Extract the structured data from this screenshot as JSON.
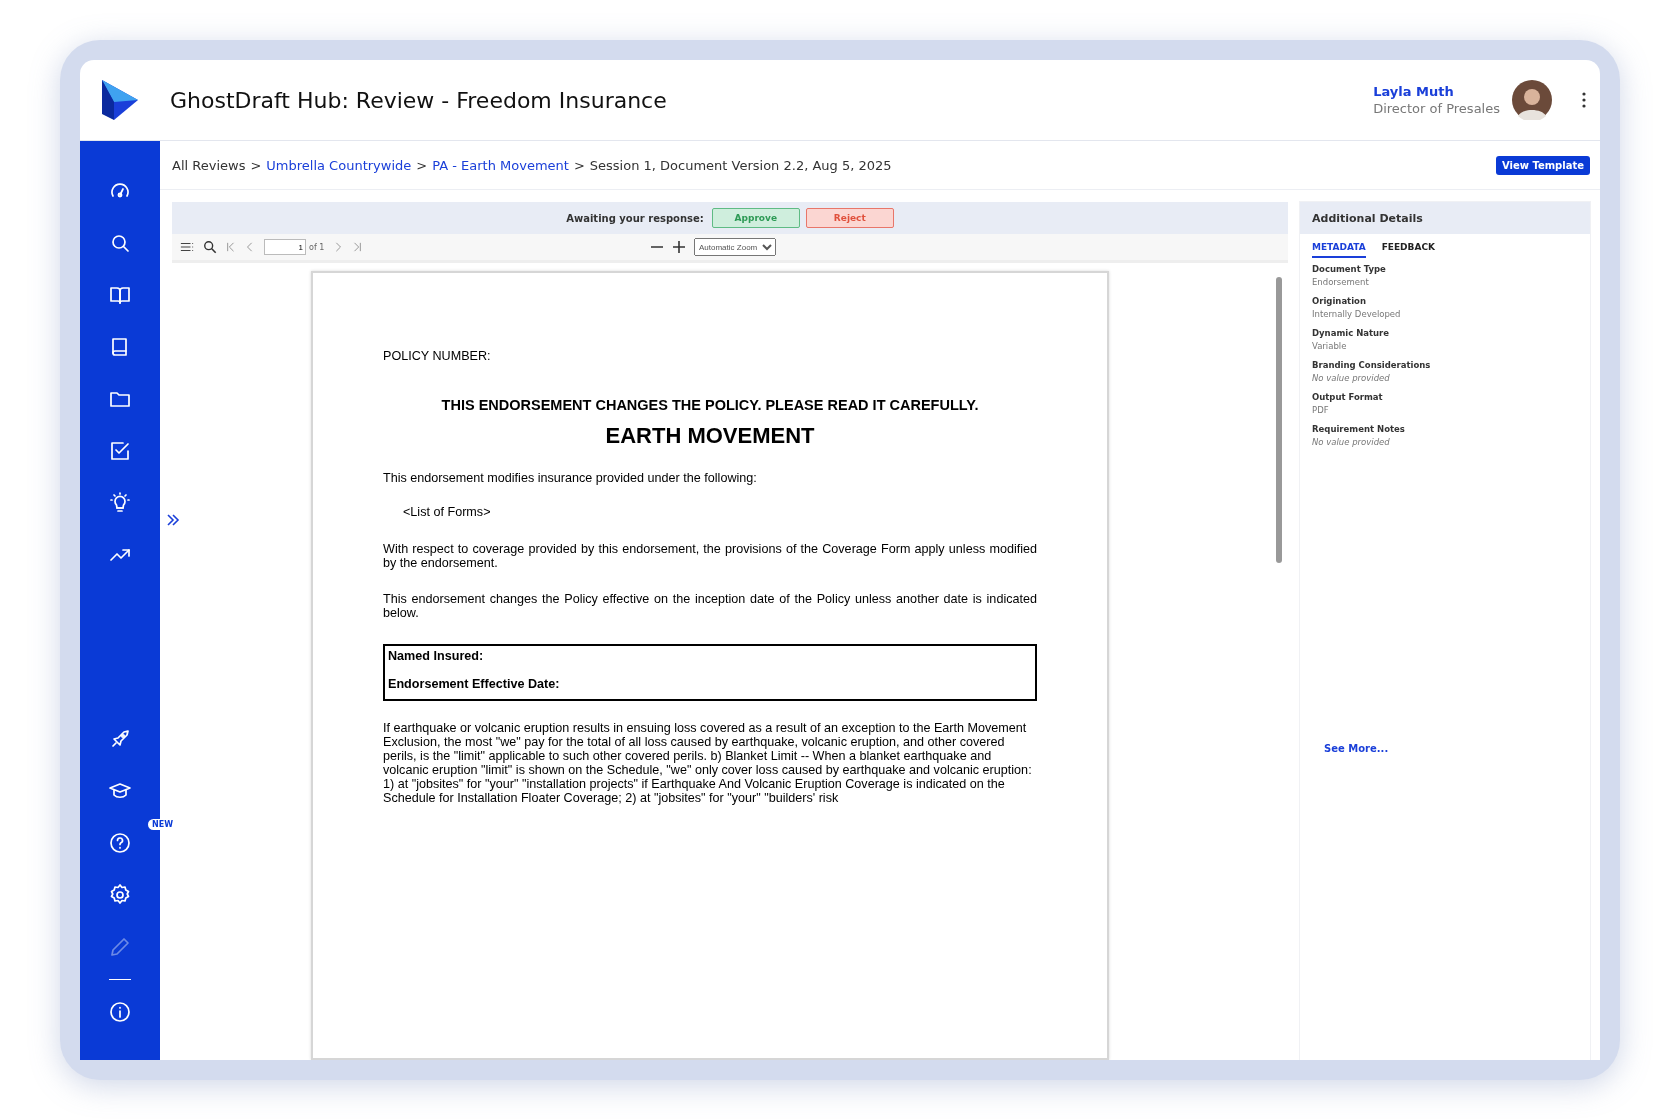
{
  "app": {
    "title": "GhostDraft Hub: Review - Freedom Insurance"
  },
  "user": {
    "name": "Layla Muth",
    "role": "Director of Presales"
  },
  "sidebar": {
    "top": [
      {
        "disabled": false
      },
      {
        "disabled": false
      },
      {
        "disabled": false
      },
      {
        "disabled": false
      },
      {
        "disabled": false
      },
      {
        "disabled": false
      },
      {
        "disabled": false
      },
      {
        "disabled": false
      }
    ],
    "bottom": [
      {
        "disabled": false
      },
      {
        "disabled": false
      },
      {
        "disabled": false,
        "badge": "NEW"
      },
      {
        "disabled": false
      },
      {
        "disabled": true
      },
      {
        "disabled": false
      }
    ]
  },
  "breadcrumb": [
    {
      "kind": "text",
      "label": "All Reviews"
    },
    {
      "kind": "separator",
      "label": ">"
    },
    {
      "kind": "link",
      "label": "Umbrella Countrywide"
    },
    {
      "kind": "separator",
      "label": ">"
    },
    {
      "kind": "link",
      "label": "PA - Earth Movement"
    },
    {
      "kind": "separator",
      "label": ">"
    },
    {
      "kind": "text",
      "label": "Session 1, Document Version 2.2, Aug 5, 2025"
    }
  ],
  "view_template_button": "View Template",
  "review_bar": {
    "prompt": "Awaiting your response:",
    "approve": "Approve",
    "reject": "Reject"
  },
  "viewer_toolbar": {
    "page": "1",
    "page_count": "of 1",
    "zoom": "Automatic Zoom"
  },
  "document": {
    "blocks": [
      {
        "kind": "plain",
        "text": "POLICY NUMBER:"
      },
      {
        "kind": "notice",
        "text": "THIS ENDORSEMENT CHANGES THE POLICY.  PLEASE READ IT CAREFULLY."
      },
      {
        "kind": "title",
        "text": "EARTH MOVEMENT"
      },
      {
        "kind": "plain",
        "text": "This endorsement modifies insurance provided under the following:"
      },
      {
        "kind": "indent",
        "text": "<List of Forms>"
      },
      {
        "kind": "justify",
        "text": "With respect to coverage provided by this endorsement, the provisions of the Coverage Form apply unless modified by the endorsement."
      },
      {
        "kind": "justify",
        "text": "This endorsement changes the Policy effective on the inception date of the Policy unless another date is indicated below."
      },
      {
        "kind": "box",
        "lines": [
          "Named Insured:",
          "Endorsement Effective Date:"
        ]
      },
      {
        "kind": "plain",
        "text": "If earthquake or volcanic eruption results in ensuing loss covered as a result of an exception to the Earth Movement Exclusion, the most \"we\" pay for the total of all loss caused by earthquake, volcanic eruption, and other covered perils, is the \"limit\" applicable to such other covered perils. b) Blanket Limit -- When a blanket earthquake and volcanic eruption \"limit\" is shown on the Schedule, \"we\" only cover loss caused by earthquake and volcanic eruption: 1) at \"jobsites\" for \"your\" \"installation projects\" if Earthquake And Volcanic Eruption Coverage is indicated on the Schedule for Installation Floater Coverage; 2) at \"jobsites\" for \"your\" \"builders' risk"
      }
    ]
  },
  "details": {
    "title": "Additional Details",
    "tabs": [
      {
        "label": "METADATA",
        "selected": true
      },
      {
        "label": "FEEDBACK",
        "selected": false
      }
    ],
    "fields": [
      {
        "label": "Document Type",
        "value": "Endorsement",
        "missing": false
      },
      {
        "label": "Origination",
        "value": "Internally Developed",
        "missing": false
      },
      {
        "label": "Dynamic Nature",
        "value": "Variable",
        "missing": false
      },
      {
        "label": "Branding Considerations",
        "value": "No value provided",
        "missing": true
      },
      {
        "label": "Output Format",
        "value": "PDF",
        "missing": false
      },
      {
        "label": "Requirement Notes",
        "value": "No value provided",
        "missing": true
      }
    ],
    "see_more": "See More..."
  }
}
